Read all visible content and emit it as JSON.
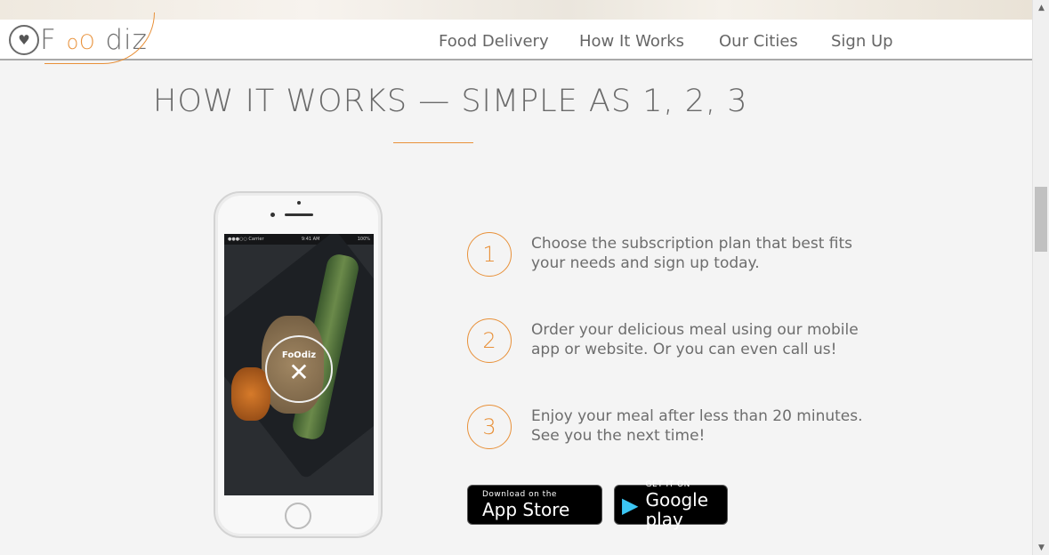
{
  "brand": {
    "logo_text_prefix": "F",
    "logo_text_middle": "oO",
    "logo_text_suffix": "diz",
    "accent": "#e8913a"
  },
  "nav": {
    "items": [
      {
        "label": "Food Delivery"
      },
      {
        "label": "How It Works"
      },
      {
        "label": "Our Cities"
      },
      {
        "label": "Sign Up"
      }
    ]
  },
  "section": {
    "title": "HOW IT WORKS — SIMPLE AS 1, 2, 3"
  },
  "phone": {
    "status_left": "●●●○○ Carrier",
    "status_time": "9:41 AM",
    "status_right": "100%",
    "app_name": "FoOdiz"
  },
  "steps": [
    {
      "number": "1",
      "text": "Choose the subscription plan that best fits your needs and sign up today."
    },
    {
      "number": "2",
      "text": "Order your delicious meal using our mobile app or website. Or you can even call us!"
    },
    {
      "number": "3",
      "text": "Enjoy your meal after less than 20 minutes. See you the next time!"
    }
  ],
  "stores": {
    "apple": {
      "small": "Download on the",
      "big": "App Store",
      "icon": "apple-icon"
    },
    "google": {
      "small": "GET IT ON",
      "big": "Google play",
      "icon": "google-play-icon"
    }
  }
}
